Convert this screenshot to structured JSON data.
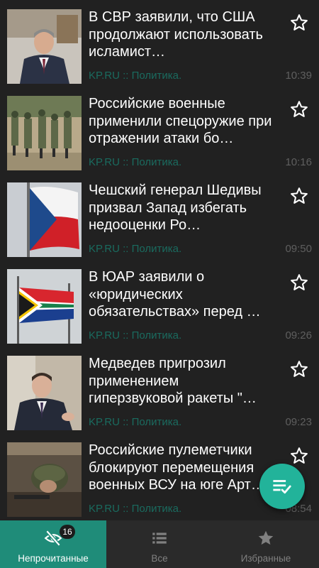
{
  "feed": {
    "items": [
      {
        "title": "В СВР заявили, что США продолжают использовать исламист…",
        "source": "KP.RU :: Политика.",
        "time": "10:39",
        "thumbnail_icon": "portrait-man-suit-icon"
      },
      {
        "title": "Российские военные применили спецоружие при отражении атаки бо…",
        "source": "KP.RU :: Политика.",
        "time": "10:16",
        "thumbnail_icon": "soldiers-training-icon"
      },
      {
        "title": "Чешский генерал Шедивы призвал Запад избегать недооценки Ро…",
        "source": "KP.RU :: Политика.",
        "time": "09:50",
        "thumbnail_icon": "czech-flag-icon"
      },
      {
        "title": "В ЮАР заявили о «юридических обязательствах» перед …",
        "source": "KP.RU :: Политика.",
        "time": "09:26",
        "thumbnail_icon": "south-africa-flag-icon"
      },
      {
        "title": "Медведев пригрозил применением гиперзвуковой ракеты \"…",
        "source": "KP.RU :: Политика.",
        "time": "09:23",
        "thumbnail_icon": "portrait-man-suit-icon"
      },
      {
        "title": "Российские пулеметчики блокируют перемещения военных ВСУ на юге Арт…",
        "source": "KP.RU :: Политика.",
        "time": "08:54",
        "thumbnail_icon": "soldier-helmet-icon"
      }
    ]
  },
  "fab": {
    "icon": "mark-all-read-icon"
  },
  "bottom_nav": {
    "unread": {
      "label": "Непрочитанные",
      "badge": "16",
      "icon": "eye-off-icon"
    },
    "all": {
      "label": "Все",
      "icon": "list-icon"
    },
    "favorites": {
      "label": "Избранные",
      "icon": "star-filled-icon"
    }
  },
  "colors": {
    "background": "#212121",
    "accent": "#1f8c79",
    "fab": "#22b39a",
    "source_text": "#1a6b5f",
    "time_text": "#5f5f5f"
  }
}
